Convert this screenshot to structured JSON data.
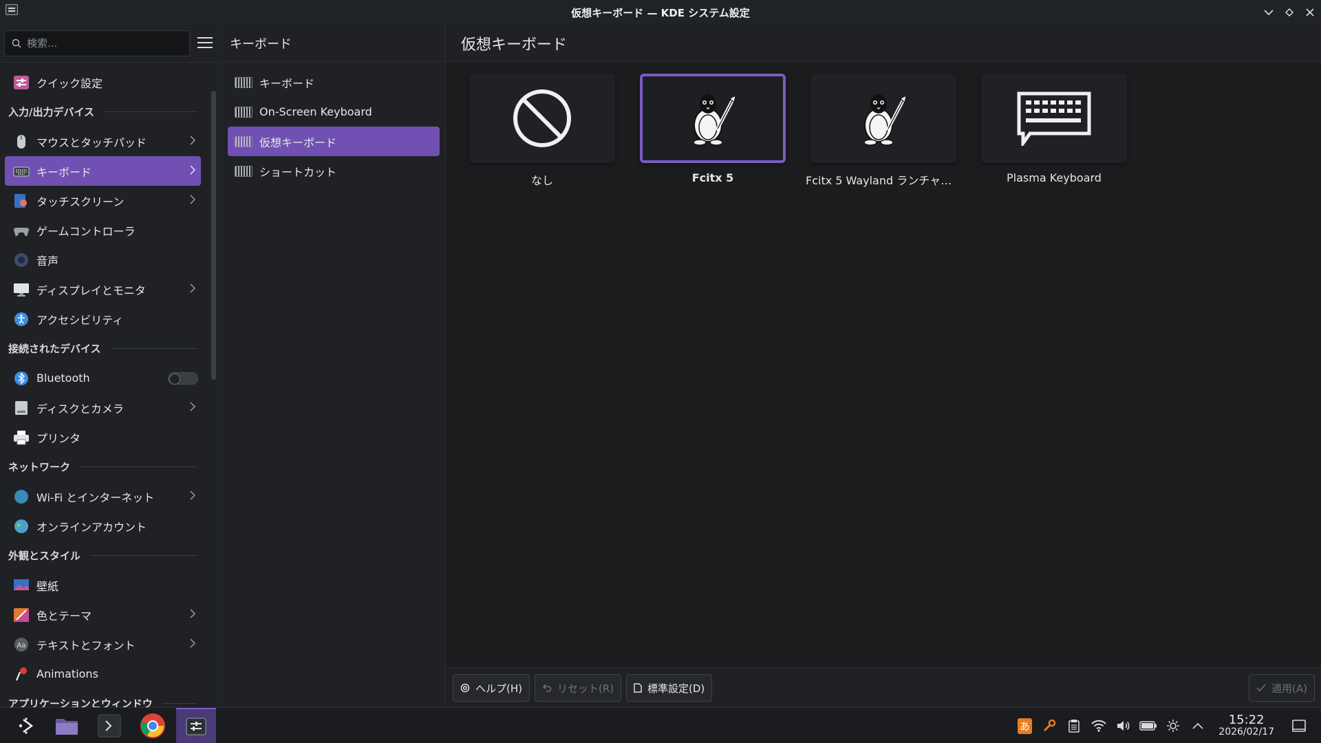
{
  "window": {
    "title": "仮想キーボード — KDE システム設定",
    "buttons": [
      "minimize",
      "maximize",
      "close"
    ]
  },
  "sidebar": {
    "search_placeholder": "検索...",
    "items": [
      {
        "type": "item",
        "label": "クイック設定",
        "icon": "quick-settings-icon",
        "color": "#c05a9a"
      },
      {
        "type": "section",
        "label": "入力/出力デバイス"
      },
      {
        "type": "item",
        "label": "マウスとタッチパッド",
        "icon": "mouse-icon",
        "chevron": true,
        "color": "#c8cbd0"
      },
      {
        "type": "item",
        "label": "キーボード",
        "icon": "keyboard-icon",
        "chevron": true,
        "active": true,
        "color": "#c8cbd0"
      },
      {
        "type": "item",
        "label": "タッチスクリーン",
        "icon": "touchscreen-icon",
        "chevron": true,
        "color": "#e07a5f"
      },
      {
        "type": "item",
        "label": "ゲームコントローラ",
        "icon": "gamepad-icon",
        "color": "#9aa0a6"
      },
      {
        "type": "item",
        "label": "音声",
        "icon": "audio-icon",
        "color": "#3c4d6a"
      },
      {
        "type": "item",
        "label": "ディスプレイとモニタ",
        "icon": "display-icon",
        "chevron": true,
        "color": "#dfe3e8"
      },
      {
        "type": "item",
        "label": "アクセシビリティ",
        "icon": "accessibility-icon",
        "color": "#3d8ee0"
      },
      {
        "type": "section",
        "label": "接続されたデバイス"
      },
      {
        "type": "item",
        "label": "Bluetooth",
        "icon": "bluetooth-icon",
        "toggle": true,
        "color": "#3d8ee0"
      },
      {
        "type": "item",
        "label": "ディスクとカメラ",
        "icon": "disk-camera-icon",
        "chevron": true,
        "color": "#c8cbd0"
      },
      {
        "type": "item",
        "label": "プリンタ",
        "icon": "printer-icon",
        "color": "#dfe3e8"
      },
      {
        "type": "section",
        "label": "ネットワーク"
      },
      {
        "type": "item",
        "label": "Wi-Fi とインターネット",
        "icon": "globe-icon",
        "chevron": true,
        "color": "#3d9a6a"
      },
      {
        "type": "item",
        "label": "オンラインアカウント",
        "icon": "online-accounts-icon",
        "color": "#4aa0c8"
      },
      {
        "type": "section",
        "label": "外観とスタイル"
      },
      {
        "type": "item",
        "label": "壁紙",
        "icon": "wallpaper-icon",
        "color": "#c05a9a"
      },
      {
        "type": "item",
        "label": "色とテーマ",
        "icon": "color-theme-icon",
        "chevron": true,
        "color": "#e07a2f"
      },
      {
        "type": "item",
        "label": "テキストとフォント",
        "icon": "font-icon",
        "chevron": true,
        "color": "#5a5e64"
      },
      {
        "type": "item",
        "label": "Animations",
        "icon": "animations-icon",
        "color": "#e03a3a"
      },
      {
        "type": "section",
        "label": "アプリケーションとウィンドウ"
      }
    ]
  },
  "middle": {
    "title": "キーボード",
    "items": [
      {
        "label": "キーボード",
        "icon": "keyboard-icon"
      },
      {
        "label": "On-Screen Keyboard",
        "icon": "onscreen-keyboard-icon"
      },
      {
        "label": "仮想キーボード",
        "icon": "virtual-keyboard-icon",
        "active": true
      },
      {
        "label": "ショートカット",
        "icon": "shortcuts-icon"
      }
    ]
  },
  "main": {
    "title": "仮想キーボード",
    "options": [
      {
        "label": "なし",
        "icon": "none-icon"
      },
      {
        "label": "Fcitx 5",
        "icon": "fcitx-penguin-icon",
        "selected": true
      },
      {
        "label": "Fcitx 5 Wayland ランチャー...",
        "icon": "fcitx-penguin-icon"
      },
      {
        "label": "Plasma Keyboard",
        "icon": "plasma-keyboard-icon"
      }
    ],
    "footer": {
      "help": "ヘルプ(H)",
      "reset": "リセット(R)",
      "defaults": "標準設定(D)",
      "apply": "適用(A)"
    }
  },
  "taskbar": {
    "apps": [
      "application-launcher-icon",
      "file-manager-icon",
      "terminal-icon",
      "chrome-icon",
      "system-settings-icon"
    ],
    "tray": {
      "ime": "あ",
      "time": "15:22",
      "date": "2026/02/17"
    }
  },
  "colors": {
    "accent": "#7051b3",
    "selected_border": "#7a5bc4",
    "background": "#1b1c1e"
  }
}
